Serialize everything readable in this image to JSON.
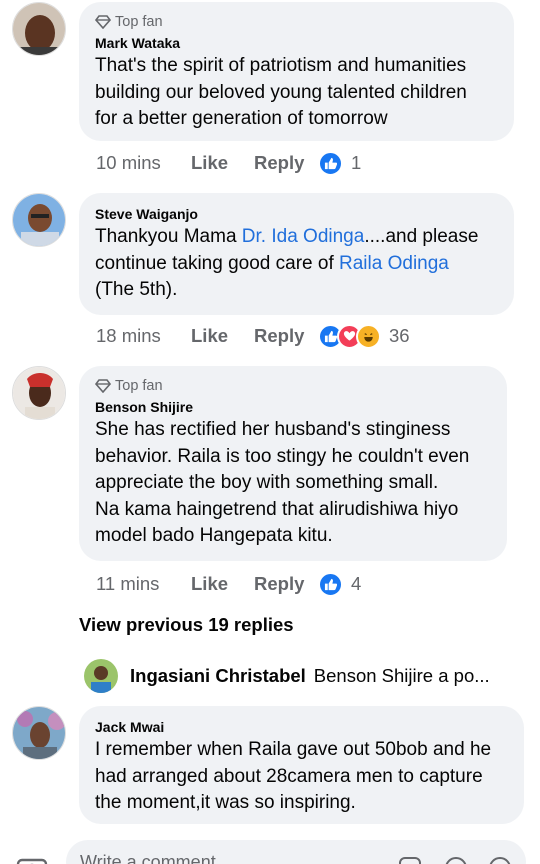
{
  "comments": [
    {
      "badge": "Top fan",
      "author": "Mark Wataka",
      "text_lines": [
        "That's the spirit of patriotism and humanities",
        "building our beloved young talented children",
        "for a better generation of tomorrow"
      ],
      "time": "10 mins",
      "like": "Like",
      "reply": "Reply",
      "reaction_count": "1"
    },
    {
      "badge": "",
      "author": "Steve Waiganjo",
      "text_parts": [
        "Thankyou Mama ",
        "Dr. Ida Odinga",
        "....and please",
        "continue taking good care of ",
        "Raila Odinga",
        "(The 5th)."
      ],
      "time": "18 mins",
      "like": "Like",
      "reply": "Reply",
      "reaction_count": "36"
    },
    {
      "badge": "Top fan",
      "author": "Benson Shijire",
      "text_lines": [
        "She has rectified her husband's stinginess",
        "behavior. Raila is too stingy he couldn't even",
        "appreciate the boy with something small.",
        "Na kama haingetrend that alirudishiwa hiyo",
        "model bado Hangepata kitu."
      ],
      "time": "11 mins",
      "like": "Like",
      "reply": "Reply",
      "reaction_count": "4"
    },
    {
      "badge": "",
      "author": "Jack Mwai",
      "text_lines": [
        "I remember when Raila gave out 50bob and he",
        "had arranged about 28camera men to capture",
        "the moment,it was so inspiring."
      ]
    }
  ],
  "view_previous": "View previous 19 replies",
  "reply_preview": {
    "name": "Ingasiani Christabel",
    "snippet": "Benson Shijire a po..."
  },
  "composer": {
    "placeholder": "Write a comment..."
  },
  "colors": {
    "bubble": "#f0f2f5",
    "link": "#216fdb",
    "like_blue": "#1877f2",
    "secondary_text": "#65676b"
  }
}
